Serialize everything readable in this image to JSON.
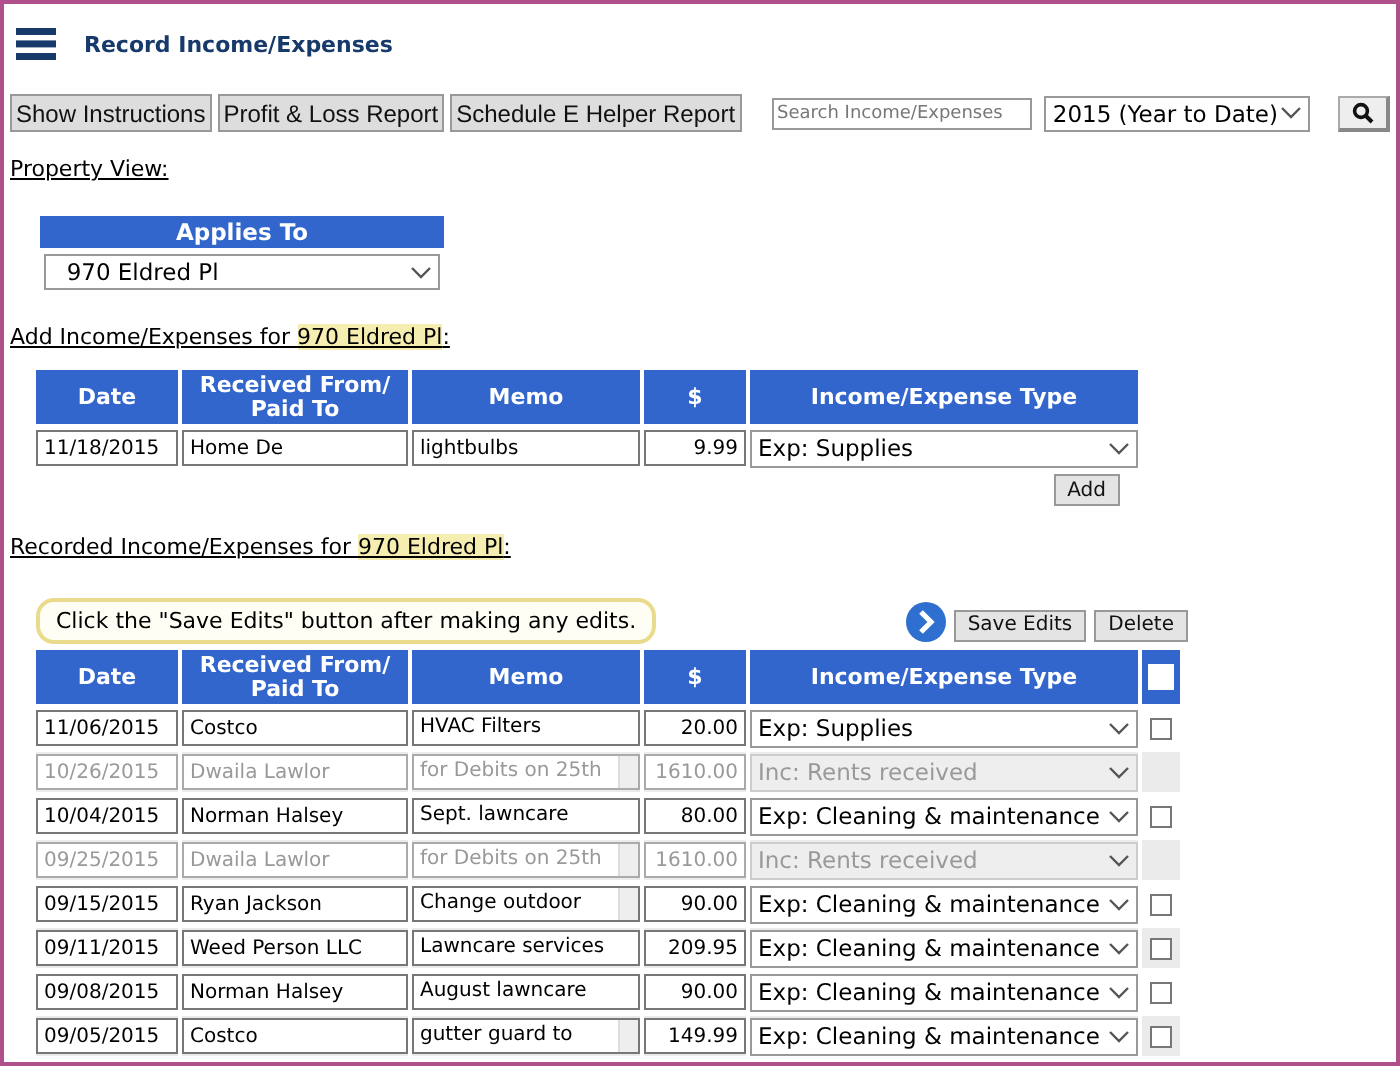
{
  "title": "Record Income/Expenses",
  "toolbar": {
    "buttons": [
      "Show Instructions",
      "Profit & Loss Report",
      "Schedule E Helper Report"
    ],
    "search": {
      "placeholder": "Search Income/Expenses"
    },
    "period": "2015 (Year to Date)"
  },
  "property_view": {
    "label": "Property View:",
    "header": "Applies To",
    "value": "970 Eldred Pl"
  },
  "add_section": {
    "label": "Add Income/Expenses for ",
    "property": "970 Eldred Pl",
    "suffix": ":",
    "columns": [
      "Date",
      "Received From/ Paid To",
      "Memo",
      "$",
      "Income/Expense Type"
    ],
    "row": {
      "date": "11/18/2015",
      "party": "Home De",
      "memo": "lightbulbs",
      "amount": "9.99",
      "type": "Exp: Supplies"
    },
    "button": "Add"
  },
  "recorded_section": {
    "label": "Recorded Income/Expenses for ",
    "property": "970 Eldred Pl",
    "suffix": ":",
    "notice": "Click the \"Save Edits\" button after making any edits.",
    "buttons": [
      "Save Edits",
      "Delete"
    ],
    "columns": [
      "Date",
      "Received From/ Paid To",
      "Memo",
      "$",
      "Income/Expense Type"
    ],
    "select_all": {
      "checked": false
    },
    "rows": [
      {
        "date": "11/06/2015",
        "party": "Costco",
        "memo": "HVAC Filters",
        "memo_scroll": false,
        "amount": "20.00",
        "type": "Exp: Supplies",
        "disabled": false,
        "checked": false
      },
      {
        "date": "10/26/2015",
        "party": "Dwaila Lawlor",
        "memo": "for Debits on 25th",
        "memo_scroll": true,
        "amount": "1610.00",
        "type": "Inc: Rents received",
        "disabled": true
      },
      {
        "date": "10/04/2015",
        "party": "Norman Halsey",
        "memo": "Sept. lawncare",
        "memo_scroll": false,
        "amount": "80.00",
        "type": "Exp: Cleaning & maintenance",
        "disabled": false,
        "checked": false
      },
      {
        "date": "09/25/2015",
        "party": "Dwaila Lawlor",
        "memo": "for Debits on 25th",
        "memo_scroll": true,
        "amount": "1610.00",
        "type": "Inc: Rents received",
        "disabled": true
      },
      {
        "date": "09/15/2015",
        "party": "Ryan Jackson",
        "memo": "Change outdoor",
        "memo_scroll": true,
        "amount": "90.00",
        "type": "Exp: Cleaning & maintenance",
        "disabled": false,
        "checked": false
      },
      {
        "date": "09/11/2015",
        "party": "Weed Person LLC",
        "memo": "Lawncare services",
        "memo_scroll": false,
        "amount": "209.95",
        "type": "Exp: Cleaning & maintenance",
        "disabled": false,
        "checked": false
      },
      {
        "date": "09/08/2015",
        "party": "Norman Halsey",
        "memo": "August lawncare",
        "memo_scroll": false,
        "amount": "90.00",
        "type": "Exp: Cleaning & maintenance",
        "disabled": false,
        "checked": false
      },
      {
        "date": "09/05/2015",
        "party": "Costco",
        "memo": "gutter guard to",
        "memo_scroll": true,
        "amount": "149.99",
        "type": "Exp: Cleaning & maintenance",
        "disabled": false,
        "checked": false
      }
    ]
  }
}
